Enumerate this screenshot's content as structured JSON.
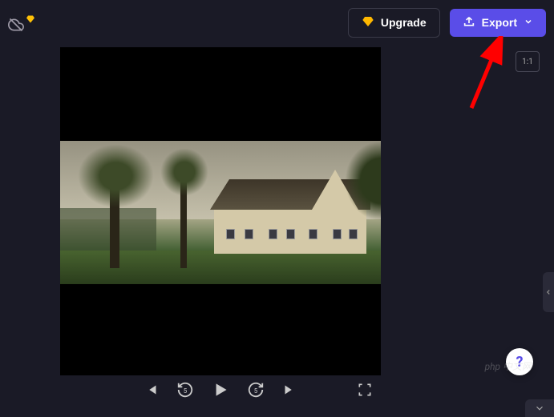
{
  "toolbar": {
    "upgrade_label": "Upgrade",
    "export_label": "Export"
  },
  "aspect_ratio": {
    "label": "1:1"
  },
  "controls": {
    "previous": "previous-frame",
    "rewind5": "rewind-5s",
    "play": "play",
    "forward5": "forward-5s",
    "next": "next-frame",
    "fullscreen": "fullscreen"
  },
  "watermark": "php 中文网"
}
